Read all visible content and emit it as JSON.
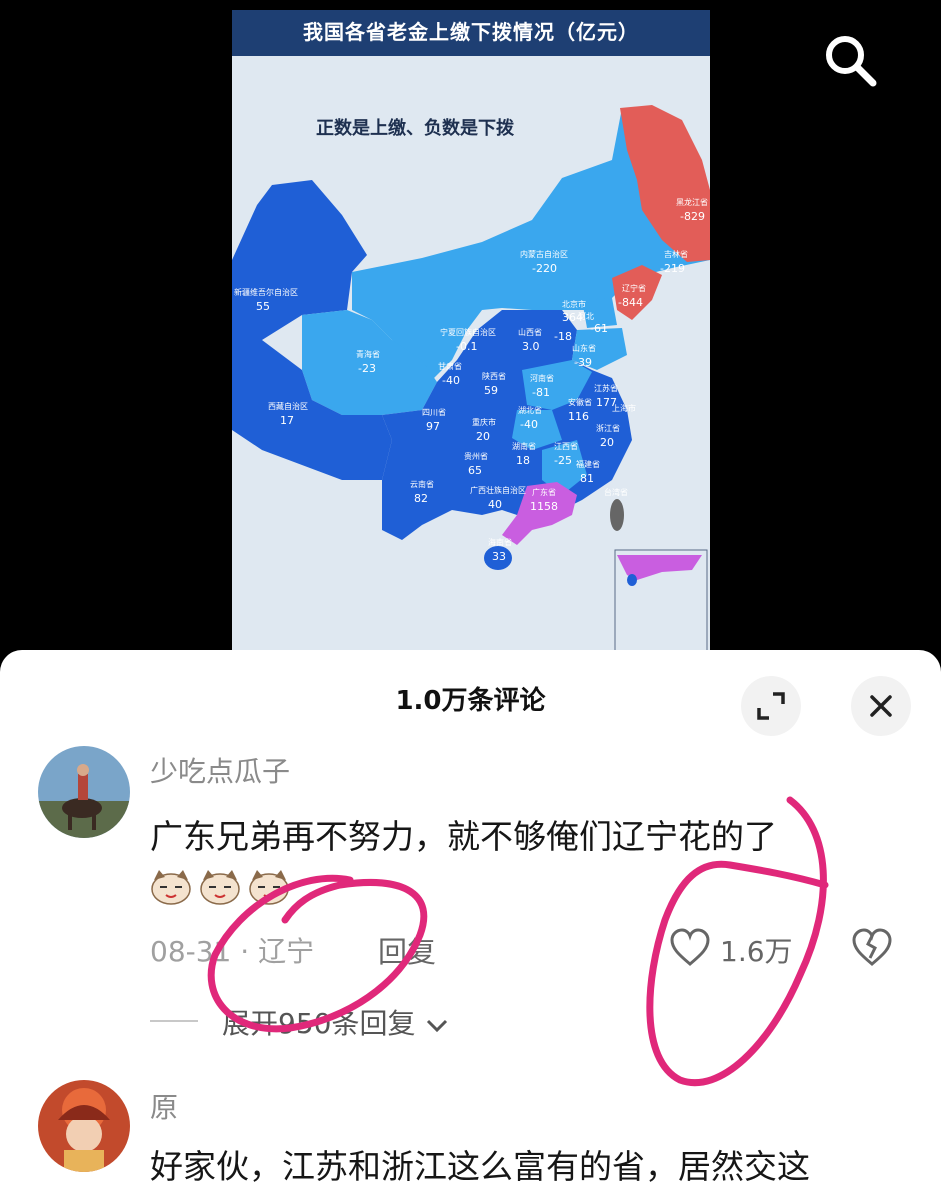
{
  "map": {
    "title": "我国各省老金上缴下拨情况（亿元）",
    "subtitle": "正数是上缴、负数是下拨",
    "provinces": [
      {
        "label": "黑龙江省",
        "value": "-829"
      },
      {
        "label": "吉林省",
        "value": "-219"
      },
      {
        "label": "辽宁省",
        "value": "-844"
      },
      {
        "label": "内蒙古自治区",
        "value": "-220"
      },
      {
        "label": "新疆维吾尔自治区",
        "value": "55"
      },
      {
        "label": "北京市",
        "value": "364"
      },
      {
        "label": "河北",
        "value": "-61"
      },
      {
        "label": "-18",
        "value": ""
      },
      {
        "label": "宁夏回族自治区",
        "value": "-0.1"
      },
      {
        "label": "山西省",
        "value": "3.0"
      },
      {
        "label": "山东省",
        "value": "-39"
      },
      {
        "label": "青海省",
        "value": "-23"
      },
      {
        "label": "甘肃省",
        "value": "-40"
      },
      {
        "label": "陕西省",
        "value": "59"
      },
      {
        "label": "河南省",
        "value": "-81"
      },
      {
        "label": "江苏省",
        "value": "177"
      },
      {
        "label": "西藏自治区",
        "value": "17"
      },
      {
        "label": "四川省",
        "value": "97"
      },
      {
        "label": "湖北省",
        "value": "-40"
      },
      {
        "label": "安徽省",
        "value": "116"
      },
      {
        "label": "上海市",
        "value": ""
      },
      {
        "label": "重庆市",
        "value": "20"
      },
      {
        "label": "浙江省",
        "value": "20"
      },
      {
        "label": "湖南省",
        "value": "18"
      },
      {
        "label": "江西省",
        "value": "-25"
      },
      {
        "label": "贵州省",
        "value": "65"
      },
      {
        "label": "福建省",
        "value": "81"
      },
      {
        "label": "云南省",
        "value": "82"
      },
      {
        "label": "广西壮族自治区",
        "value": "40"
      },
      {
        "label": "广东省",
        "value": "1158"
      },
      {
        "label": "台湾省",
        "value": ""
      },
      {
        "label": "海南省",
        "value": "33"
      }
    ],
    "colors": {
      "deficit": "#e25d58",
      "surplus": "#1f5fd6",
      "light": "#3aa7ee",
      "guangdong": "#c95ee0",
      "title_bg": "#1e3f73"
    }
  },
  "icons": {
    "search": "search-icon",
    "expand": "expand-icon",
    "close": "close-icon",
    "like": "heart-outline-icon",
    "dislike": "broken-heart-icon"
  },
  "panel": {
    "title": "1.0万条评论",
    "comments": [
      {
        "user": "少吃点瓜子",
        "text": "广东兄弟再不努力，就不够俺们辽宁花的了",
        "emoji_count": 3,
        "date": "08-31",
        "location": "辽宁",
        "meta": "08-31 · 辽宁",
        "reply_label": "回复",
        "likes": "1.6万",
        "expand_label": "展开950条回复"
      },
      {
        "user": "原",
        "text": "好家伙，江苏和浙江这么富有的省，居然交这"
      }
    ]
  }
}
